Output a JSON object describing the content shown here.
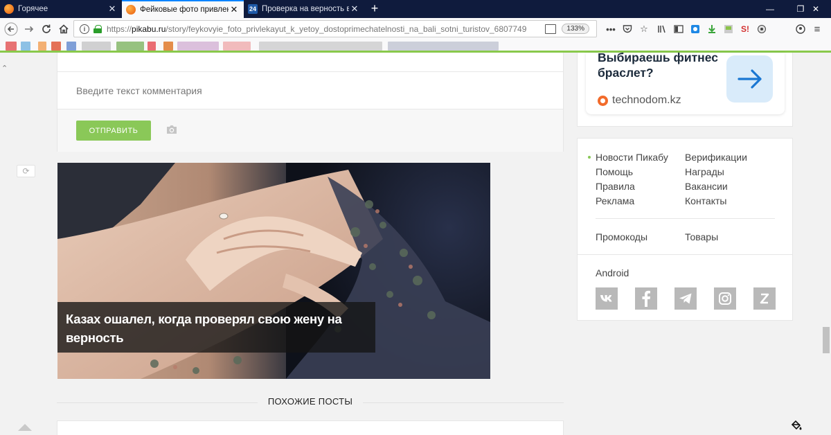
{
  "browser": {
    "tabs": [
      {
        "label": "Горячее",
        "icon": "pikabu-favicon",
        "active": false
      },
      {
        "label": "Фейковые фото привлекают т",
        "icon": "pikabu-favicon",
        "active": true
      },
      {
        "label": "Проверка на верность в каза",
        "icon": "24kz-favicon",
        "favicon_text": "24",
        "active": false
      }
    ],
    "url_prefix": "https://",
    "url_host": "pikabu.ru",
    "url_path": "/story/feykovyie_foto_privlekayut_k_yetoy_dostoprimechatelnosti_na_bali_sotni_turistov_6807749",
    "zoom": "133%"
  },
  "comment": {
    "placeholder": "Введите текст комментария",
    "send_label": "ОТПРАВИТЬ"
  },
  "post": {
    "caption": "Казах ошалел, когда проверял свою жену на верность"
  },
  "similar": {
    "heading": "ПОХОЖИЕ ПОСТЫ"
  },
  "ad": {
    "title": "Выбираешь фитнес браслет?",
    "site": "technodom.kz"
  },
  "footer_links": {
    "col1": [
      "Новости Пикабу",
      "Помощь",
      "Правила",
      "Реклама"
    ],
    "col2": [
      "Верификации",
      "Награды",
      "Вакансии",
      "Контакты"
    ],
    "extra1": "Промокоды",
    "extra2": "Товары",
    "android": "Android"
  },
  "social": [
    "vk-icon",
    "facebook-icon",
    "telegram-icon",
    "instagram-icon",
    "zen-icon"
  ],
  "colors": {
    "accent_green": "#8ac858",
    "tabbar": "#0f1b3d",
    "active_tab_line": "#0a84ff",
    "social_gray": "#b9b9b9"
  }
}
